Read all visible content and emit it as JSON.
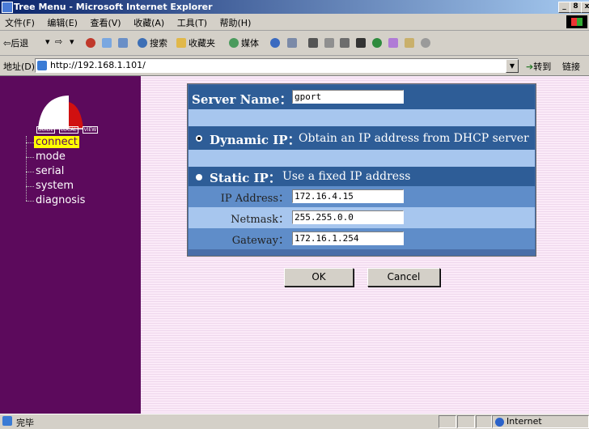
{
  "window": {
    "title": "Tree Menu - Microsoft Internet Explorer",
    "controls": [
      "_",
      "8",
      "x"
    ]
  },
  "menubar": [
    "文件(F)",
    "编辑(E)",
    "查看(V)",
    "收藏(A)",
    "工具(T)",
    "帮助(H)"
  ],
  "toolbar": {
    "back": "⇦后退",
    "search": "搜索",
    "favorites": "收藏夹",
    "media": "媒体"
  },
  "address": {
    "label": "地址(D)",
    "url": "http://192.168.1.101/",
    "go": "转到",
    "links": "链接"
  },
  "logo": {
    "labels": [
      "GUIDE",
      "LOCAL",
      "VIEW"
    ],
    "colors": {
      "white": "#ffffff",
      "red": "#d01010"
    }
  },
  "tree": {
    "items": [
      "connect",
      "mode",
      "serial",
      "system",
      "diagnosis"
    ],
    "selected": "connect"
  },
  "form": {
    "server_name_label": "Server Name：",
    "server_name_value": "gport",
    "dynamic_title": "Dynamic IP：",
    "dynamic_desc": "Obtain an IP address from DHCP server",
    "static_title": "Static IP：",
    "static_desc": "Use a fixed IP address",
    "ip_label": "IP Address：",
    "ip_value": "172.16.4.15",
    "netmask_label": "Netmask：",
    "netmask_value": "255.255.0.0",
    "gateway_label": "Gateway：",
    "gateway_value": "172.16.1.254",
    "selected_mode": "dynamic"
  },
  "buttons": {
    "ok": "OK",
    "cancel": "Cancel"
  },
  "status": {
    "text": "完毕",
    "zone": "Internet"
  },
  "colors": {
    "sidebar": "#5c0a5c",
    "panel_dark": "#2e5d97",
    "panel_light": "#a7c6ee",
    "selected_bg": "#ffff00"
  }
}
